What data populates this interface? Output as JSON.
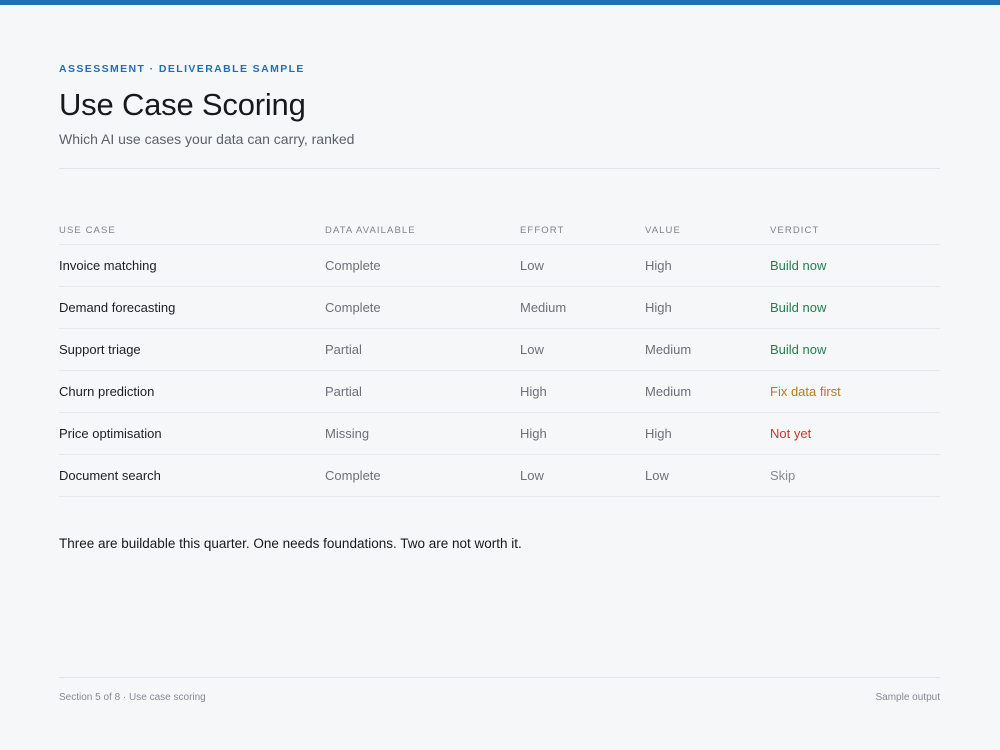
{
  "header": {
    "eyebrow": "ASSESSMENT · DELIVERABLE SAMPLE",
    "title": "Use Case Scoring",
    "subtitle": "Which AI use cases your data can carry, ranked"
  },
  "table": {
    "columns": [
      "USE CASE",
      "DATA AVAILABLE",
      "EFFORT",
      "VALUE",
      "VERDICT"
    ],
    "rows": [
      {
        "use_case": "Invoice matching",
        "data": "Complete",
        "effort": "Low",
        "value": "High",
        "verdict": "Build now",
        "verdict_color": "#2a7a4f"
      },
      {
        "use_case": "Demand forecasting",
        "data": "Complete",
        "effort": "Medium",
        "value": "High",
        "verdict": "Build now",
        "verdict_color": "#2a7a4f"
      },
      {
        "use_case": "Support triage",
        "data": "Partial",
        "effort": "Low",
        "value": "Medium",
        "verdict": "Build now",
        "verdict_color": "#2a7a4f"
      },
      {
        "use_case": "Churn prediction",
        "data": "Partial",
        "effort": "High",
        "value": "Medium",
        "verdict": "Fix data first",
        "verdict_color": "#b7791f"
      },
      {
        "use_case": "Price optimisation",
        "data": "Missing",
        "effort": "High",
        "value": "High",
        "verdict": "Not yet",
        "verdict_color": "#c0392b"
      },
      {
        "use_case": "Document search",
        "data": "Complete",
        "effort": "Low",
        "value": "Low",
        "verdict": "Skip",
        "verdict_color": "#858a92"
      }
    ]
  },
  "summary": "Three are buildable this quarter. One needs foundations. Two are not worth it.",
  "footer": {
    "left": "Section 5 of 8 · Use case scoring",
    "right": "Sample output"
  },
  "colors": {
    "accent": "#1f6fb8",
    "background": "#f6f7f9"
  }
}
